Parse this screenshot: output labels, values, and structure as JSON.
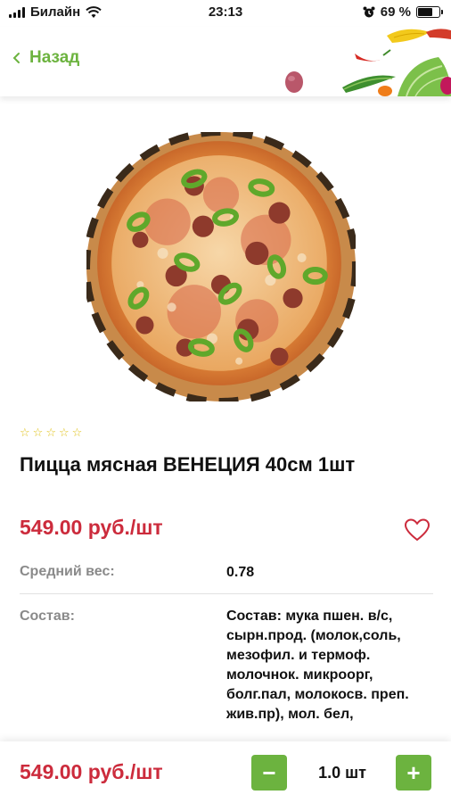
{
  "status_bar": {
    "carrier": "Билайн",
    "time": "23:13",
    "battery": "69 %",
    "battery_level": 0.69
  },
  "header": {
    "back_label": "Назад"
  },
  "product": {
    "rating_stars": 5,
    "rating_value": 0,
    "title": "Пицца мясная ВЕНЕЦИЯ 40см 1шт",
    "price": "549.00 руб./шт",
    "weight_label": "Средний вес:",
    "weight_value": "0.78",
    "composition_label": "Состав:",
    "composition_value": "Состав: мука пшен. в/с, сырн.прод. (молок,соль, мезофил. и термоф. молочнок. микроорг, болг.пал, молокосв. преп. жив.пр), мол. бел,"
  },
  "bottom_bar": {
    "price": "549.00 руб./шт",
    "minus_label": "−",
    "quantity": "1.0 шт",
    "plus_label": "+"
  },
  "colors": {
    "accent_green": "#6cb33f",
    "price_red": "#cc2b3c",
    "star_yellow": "#e0c21a"
  }
}
